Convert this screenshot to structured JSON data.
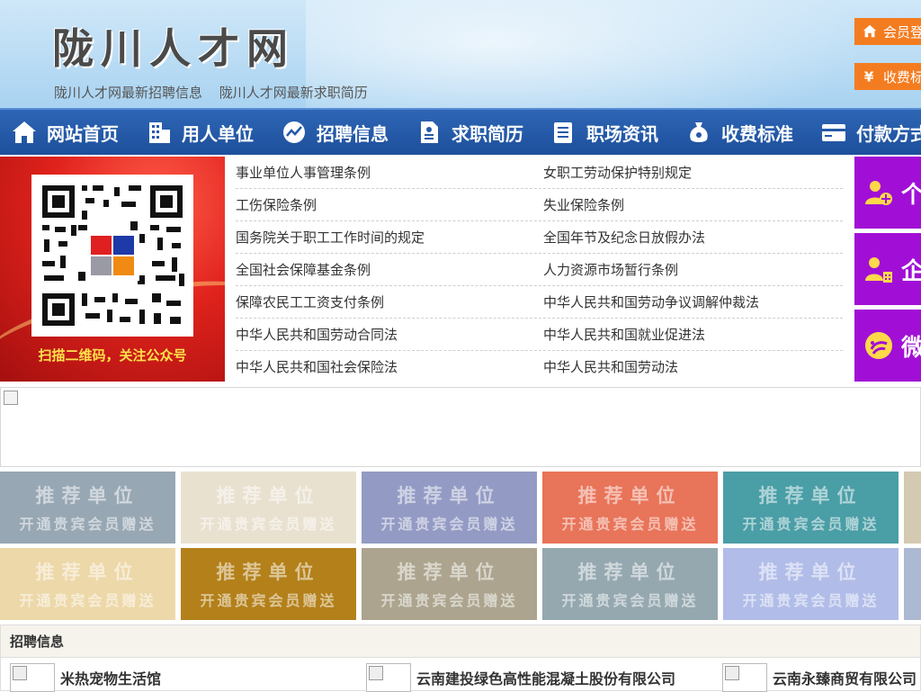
{
  "header": {
    "site_title": "陇川人才网",
    "links": [
      "陇川人才网最新招聘信息",
      "陇川人才网最新求职简历"
    ],
    "login_label": "会员登",
    "fee_label": "收费标"
  },
  "nav": [
    {
      "label": "网站首页",
      "icon": "home-icon"
    },
    {
      "label": "用人单位",
      "icon": "building-icon"
    },
    {
      "label": "招聘信息",
      "icon": "chart-icon"
    },
    {
      "label": "求职简历",
      "icon": "resume-icon"
    },
    {
      "label": "职场资讯",
      "icon": "news-icon"
    },
    {
      "label": "收费标准",
      "icon": "money-bag-icon"
    },
    {
      "label": "付款方式",
      "icon": "card-icon"
    }
  ],
  "qr": {
    "caption": "扫描二维码，关注公众号"
  },
  "laws": [
    [
      "事业单位人事管理条例",
      "女职工劳动保护特别规定"
    ],
    [
      "工伤保险条例",
      "失业保险条例"
    ],
    [
      "国务院关于职工工作时间的规定",
      "全国年节及纪念日放假办法"
    ],
    [
      "全国社会保障基金条例",
      "人力资源市场暂行条例"
    ],
    [
      "保障农民工工资支付条例",
      "中华人民共和国劳动争议调解仲裁法"
    ],
    [
      "中华人民共和国劳动合同法",
      "中华人民共和国就业促进法"
    ],
    [
      "中华人民共和国社会保险法",
      "中华人民共和国劳动法"
    ]
  ],
  "side": [
    {
      "label": "个",
      "icon": "person-add-icon"
    },
    {
      "label": "企",
      "icon": "company-person-icon"
    },
    {
      "label": "微",
      "icon": "wechat-icon"
    }
  ],
  "recommend": {
    "title": "推荐单位",
    "subtitle": "开通贵宾会员赠送",
    "row1_colors": [
      "#97a7b3",
      "#e9e1d0",
      "#939bc4",
      "#e87459",
      "#4a9ea6",
      "#d4c9b1"
    ],
    "row2_colors": [
      "#edd8a9",
      "#b3801a",
      "#aca48e",
      "#95a8b0",
      "#b1bde8",
      "#adb8d2"
    ]
  },
  "recruit": {
    "heading": "招聘信息",
    "companies": [
      "米热宠物生活馆",
      "云南建投绿色高性能混凝土股份有限公司",
      "云南永臻商贸有限公司"
    ]
  },
  "colors": {
    "nav_bg": "#2559a8",
    "accent_orange": "#f47c20",
    "side_purple": "#a10fd6"
  }
}
